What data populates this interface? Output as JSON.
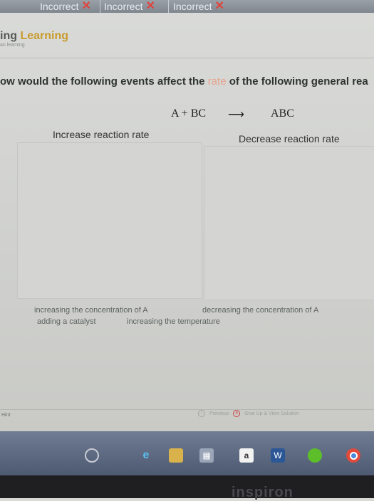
{
  "attempts": [
    {
      "label": "Incorrect"
    },
    {
      "label": "Incorrect"
    },
    {
      "label": "Incorrect"
    }
  ],
  "brand": {
    "title_prefix": "ing ",
    "title_accent": "Learning",
    "subtitle": "an learning"
  },
  "question": {
    "before": "ow would the following events affect the ",
    "highlight": "rate",
    "after": " of the following general rea"
  },
  "reaction": {
    "reactants": "A + BC",
    "arrow": "⟶",
    "product": "ABC"
  },
  "bins": {
    "left_label": "Increase reaction rate",
    "right_label": "Decrease reaction rate"
  },
  "choices": [
    "increasing the concentration of A",
    "decreasing the concentration of A",
    "adding a catalyst",
    "increasing the temperature"
  ],
  "footer": {
    "hint": "Hint",
    "previous": "Previous",
    "give_up": "Give Up & View Solution"
  },
  "taskbar": {
    "amazon_letter": "a",
    "word_letter": "W"
  },
  "bezel_brand": "inspiron",
  "colors": {
    "incorrect_x": "#e0433b",
    "brand_accent": "#c89b2e",
    "rate_highlight": "#e7a38e"
  }
}
